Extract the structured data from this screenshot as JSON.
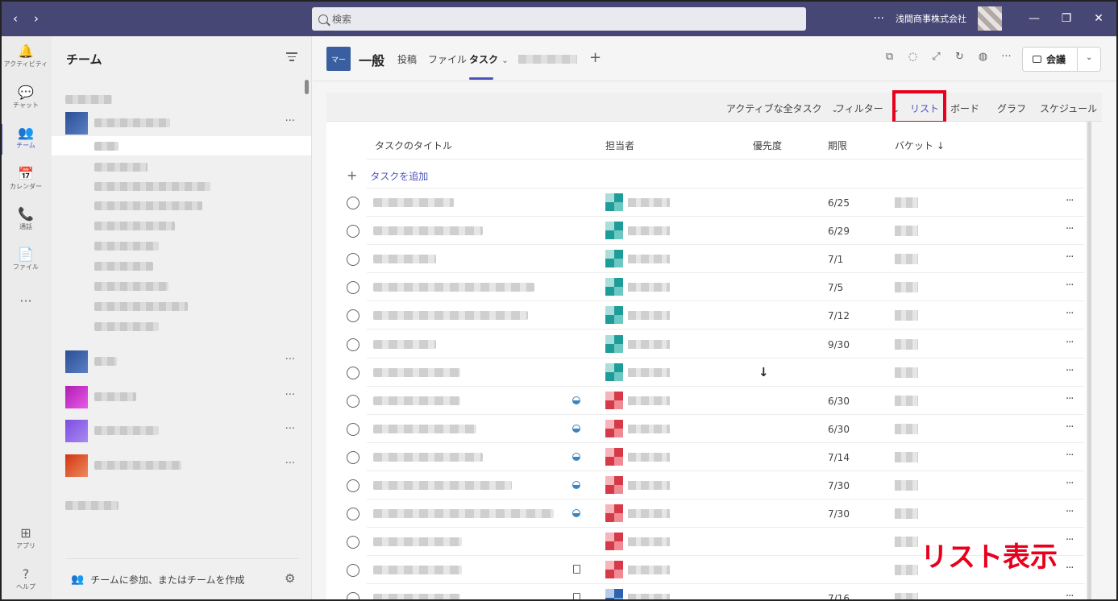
{
  "titlebar": {
    "search_placeholder": "検索",
    "more": "···",
    "org_name": "浅間商事株式会社",
    "nav_back": "‹",
    "nav_forward": "›",
    "win_min": "—",
    "win_max": "❐",
    "win_close": "✕"
  },
  "rail": [
    {
      "id": "activity",
      "label": "アクティビティ",
      "icon": "bell-icon",
      "glyph": "🔔"
    },
    {
      "id": "chat",
      "label": "チャット",
      "icon": "chat-icon",
      "glyph": "💬"
    },
    {
      "id": "teams",
      "label": "チーム",
      "icon": "teams-icon",
      "glyph": "👥"
    },
    {
      "id": "calendar",
      "label": "カレンダー",
      "icon": "calendar-icon",
      "glyph": "📅"
    },
    {
      "id": "calls",
      "label": "通話",
      "icon": "phone-icon",
      "glyph": "📞"
    },
    {
      "id": "files",
      "label": "ファイル",
      "icon": "file-icon",
      "glyph": "📄"
    },
    {
      "id": "more",
      "label": "",
      "icon": "more-icon",
      "glyph": "···"
    },
    {
      "id": "apps",
      "label": "アプリ",
      "icon": "apps-icon",
      "glyph": "⊞"
    },
    {
      "id": "help",
      "label": "ヘルプ",
      "icon": "help-icon",
      "glyph": "?"
    }
  ],
  "teams_panel": {
    "title": "チーム",
    "dots": "···",
    "footer_join": "チームに参加、またはチームを作成",
    "team_colors": [
      "#3a5fa0",
      "#3a5fa0",
      "#c21fc4",
      "#8b5cf6",
      "#d9481c"
    ]
  },
  "channel": {
    "badge": "マー",
    "name": "一般",
    "tabs": [
      "投稿",
      "ファイル",
      "タスク"
    ],
    "active_tab_chevron": "⌄",
    "add": "+",
    "meet_label": "会議",
    "meet_chevron": "⌄"
  },
  "toolbar": {
    "active_tasks": "アクティブな全タスク",
    "filter": "フィルター",
    "chevron": "⌄",
    "views": [
      "リスト",
      "ボード",
      "グラフ",
      "スケジュール"
    ]
  },
  "grid": {
    "headers": {
      "title": "タスクのタイトル",
      "assignee": "担当者",
      "priority": "優先度",
      "due": "期限",
      "bucket": "バケット ↓"
    },
    "add_task": "タスクを追加",
    "plus": "+",
    "more": "···",
    "rows": [
      {
        "due": "6/25",
        "color": "teal",
        "status": "",
        "priority": ""
      },
      {
        "due": "6/29",
        "color": "teal",
        "status": "",
        "priority": ""
      },
      {
        "due": "7/1",
        "color": "teal",
        "status": "",
        "priority": ""
      },
      {
        "due": "7/5",
        "color": "teal",
        "status": "",
        "priority": ""
      },
      {
        "due": "7/12",
        "color": "teal",
        "status": "",
        "priority": ""
      },
      {
        "due": "9/30",
        "color": "teal",
        "status": "",
        "priority": ""
      },
      {
        "due": "",
        "color": "teal",
        "status": "",
        "priority": "↓"
      },
      {
        "due": "6/30",
        "color": "red",
        "status": "progress",
        "priority": ""
      },
      {
        "due": "6/30",
        "color": "red",
        "status": "progress",
        "priority": ""
      },
      {
        "due": "7/14",
        "color": "red",
        "status": "progress",
        "priority": ""
      },
      {
        "due": "7/30",
        "color": "red",
        "status": "progress",
        "priority": ""
      },
      {
        "due": "7/30",
        "color": "red",
        "status": "progress",
        "priority": ""
      },
      {
        "due": "",
        "color": "red",
        "status": "",
        "priority": ""
      },
      {
        "due": "",
        "color": "red",
        "status": "note",
        "priority": ""
      },
      {
        "due": "7/16",
        "color": "blue",
        "status": "note",
        "priority": ""
      }
    ]
  },
  "annotation": "リスト表示",
  "colors": {
    "titlebar": "#464775",
    "accent": "#4b53bc",
    "highlight": "#e8001c"
  }
}
